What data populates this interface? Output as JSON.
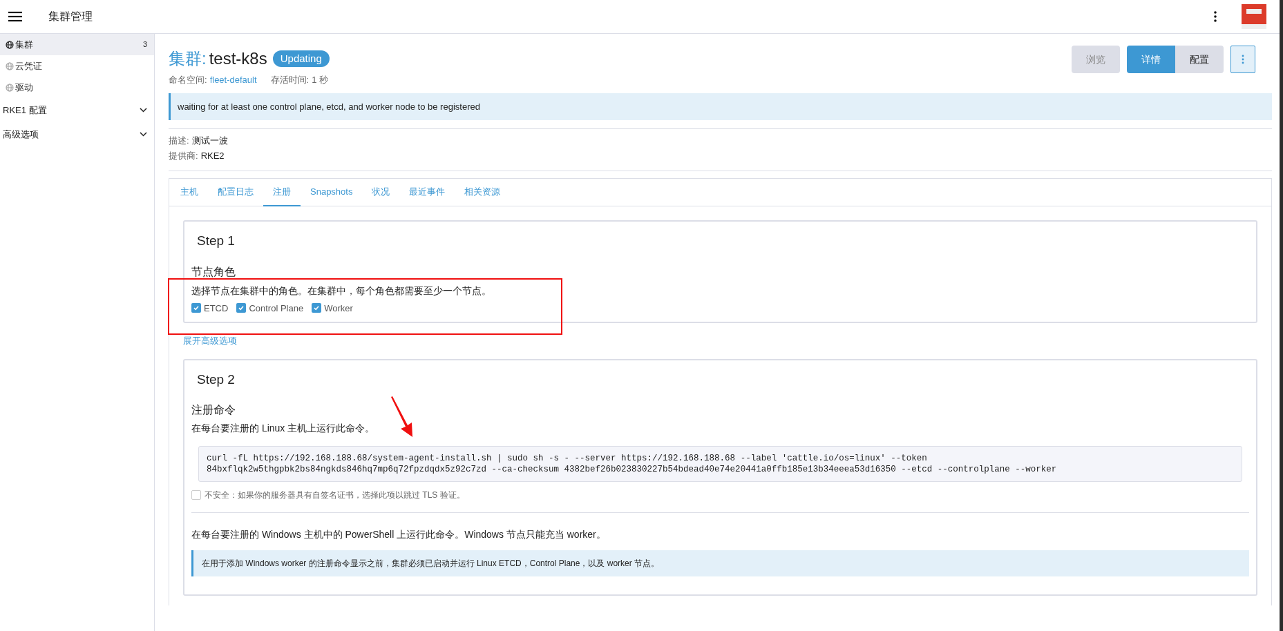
{
  "header": {
    "title": "集群管理"
  },
  "sidebar": {
    "items": [
      {
        "kind": "link",
        "label": "集群",
        "count": "3",
        "selected": true
      },
      {
        "kind": "link",
        "label": "云凭证",
        "selected": false
      },
      {
        "kind": "link",
        "label": "驱动",
        "selected": false
      },
      {
        "kind": "group",
        "label": "RKE1 配置",
        "selected": false,
        "expanded": false
      },
      {
        "kind": "group",
        "label": "高级选项",
        "selected": false,
        "expanded": false
      }
    ]
  },
  "page": {
    "type_label": "集群:",
    "name": "test-k8s",
    "status": "Updating",
    "meta": [
      {
        "label": "命名空间:",
        "value": "fleet-default",
        "link": true
      },
      {
        "label": "存活时间:",
        "value": "1 秒",
        "link": false
      }
    ],
    "view_button": {
      "label": "浏览",
      "disabled": true
    },
    "mode_toggle": [
      {
        "label": "详情",
        "selected": true
      },
      {
        "label": "配置",
        "selected": false
      }
    ],
    "banner": "waiting for at least one control plane, etcd, and worker node to be registered",
    "details": [
      {
        "label": "描述:",
        "value": "测试一波"
      },
      {
        "label": "提供商:",
        "value": "RKE2"
      }
    ]
  },
  "tabs": [
    {
      "label": "主机",
      "selected": false
    },
    {
      "label": "配置日志",
      "selected": false
    },
    {
      "label": "注册",
      "selected": true
    },
    {
      "label": "Snapshots",
      "selected": false
    },
    {
      "label": "状况",
      "selected": false
    },
    {
      "label": "最近事件",
      "selected": false
    },
    {
      "label": "相关资源",
      "selected": false
    }
  ],
  "step1": {
    "title": "Step 1",
    "heading": "节点角色",
    "description": "选择节点在集群中的角色。在集群中，每个角色都需要至少一个节点。",
    "roles": [
      {
        "label": "ETCD",
        "checked": true
      },
      {
        "label": "Control Plane",
        "checked": true
      },
      {
        "label": "Worker",
        "checked": true
      }
    ]
  },
  "advanced_link": "展开高级选项",
  "step2": {
    "title": "Step 2",
    "heading": "注册命令",
    "linux_instruction": "在每台要注册的 Linux 主机上运行此命令。",
    "command": "curl -fL https://192.168.188.68/system-agent-install.sh | sudo sh -s - --server https://192.168.188.68 --label 'cattle.io/os=linux' --token\n84bxflqk2w5thgpbk2bs84ngkds846hq7mp6q72fpzdqdx5z92c7zd --ca-checksum 4382bef26b023830227b54bdead40e74e20441a0ffb185e13b34eeea53d16350 --etcd --controlplane --worker",
    "insecure": {
      "label": "不安全：如果你的服务器具有自签名证书，选择此项以跳过 TLS 验证。",
      "checked": false
    },
    "windows_instruction": "在每台要注册的 Windows 主机中的 PowerShell 上运行此命令。Windows 节点只能充当 worker。",
    "windows_note": "在用于添加 Windows worker 的注册命令显示之前，集群必须已启动并运行 Linux ETCD，Control Plane，以及 worker 节点。"
  }
}
